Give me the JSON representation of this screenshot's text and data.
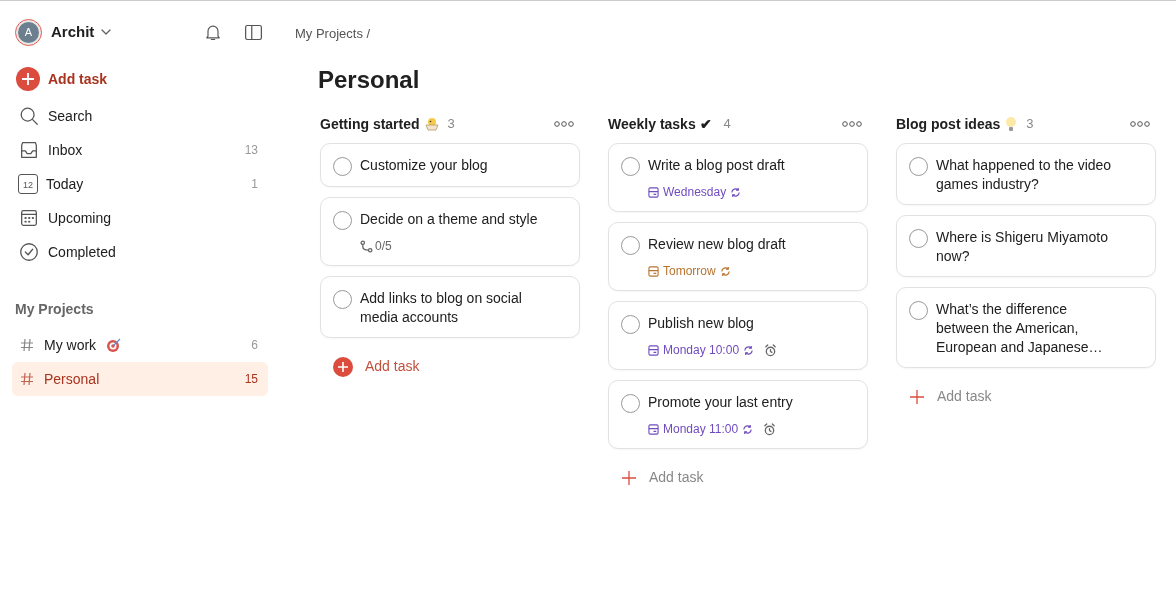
{
  "sidebar": {
    "user": {
      "initial": "A",
      "name": "Archit"
    },
    "add_task": "Add task",
    "nav": [
      {
        "kind": "search",
        "label": "Search",
        "selected": false
      },
      {
        "kind": "inbox",
        "label": "Inbox",
        "count": "13",
        "selected": false
      },
      {
        "kind": "today",
        "label": "Today",
        "count": "1",
        "today_number": "12",
        "selected": false
      },
      {
        "kind": "upcoming",
        "label": "Upcoming",
        "selected": false
      },
      {
        "kind": "completed",
        "label": "Completed",
        "selected": false
      }
    ],
    "projects_heading": "My Projects",
    "projects": [
      {
        "name": "My work",
        "kind": "target",
        "count": "6",
        "selected": false
      },
      {
        "name": "Personal",
        "kind": "plain",
        "count": "15",
        "selected": true
      }
    ]
  },
  "breadcrumb": "My Projects /",
  "title": "Personal",
  "sections": [
    {
      "title": "Getting started",
      "kind": "chick",
      "count": "3",
      "add_highlighted": true,
      "add_label": "Add task",
      "tasks": [
        {
          "title": "Customize your blog",
          "checked": false
        },
        {
          "title": "Decide on a theme and style",
          "subtasks": "0/5",
          "checked": false
        },
        {
          "title": "Add links to blog on social media accounts",
          "checked": false
        }
      ]
    },
    {
      "title": "Weekly tasks ✔",
      "kind": "plain",
      "count": "4",
      "add_highlighted": false,
      "add_label": "Add task",
      "tasks": [
        {
          "title": "Write a blog post draft",
          "checked": false,
          "due": "Wednesday",
          "color": "#6f4cbf",
          "repeat": true,
          "alarm": false
        },
        {
          "title": "Review new blog draft",
          "checked": false,
          "due": "Tomorrow",
          "color": "#b8732e",
          "repeat": true,
          "alarm": false
        },
        {
          "title": "Publish new blog",
          "checked": false,
          "due": "Monday 10:00",
          "color": "#6f4cbf",
          "repeat": true,
          "alarm": true
        },
        {
          "title": "Promote your last entry",
          "checked": false,
          "due": "Monday 11:00",
          "color": "#6f4cbf",
          "repeat": true,
          "alarm": true
        }
      ]
    },
    {
      "title": "Blog post ideas",
      "kind": "bulb",
      "count": "3",
      "add_highlighted": false,
      "add_label": "Add task",
      "tasks": [
        {
          "title": "What happened to the video games industry?",
          "checked": false
        },
        {
          "title": "Where is Shigeru Miyamoto now?",
          "checked": false
        },
        {
          "title": "What’s the difference between the American, European and Japanese…",
          "checked": false
        }
      ]
    }
  ]
}
